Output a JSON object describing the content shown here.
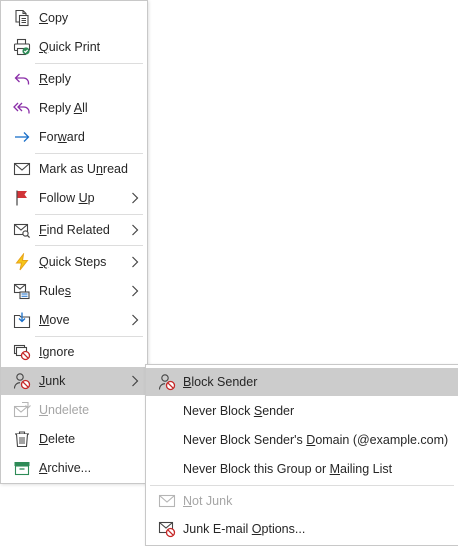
{
  "menu": {
    "items": [
      {
        "pre": "",
        "key": "C",
        "post": "opy",
        "icon": "copy-icon"
      },
      {
        "pre": "",
        "key": "Q",
        "post": "uick Print",
        "icon": "quick-print-icon"
      },
      {
        "pre": "",
        "key": "R",
        "post": "eply",
        "icon": "reply-icon"
      },
      {
        "pre": "Reply ",
        "key": "A",
        "post": "ll",
        "icon": "reply-all-icon"
      },
      {
        "pre": "For",
        "key": "w",
        "post": "ard",
        "icon": "forward-icon"
      },
      {
        "pre": "Mark as U",
        "key": "n",
        "post": "read",
        "icon": "envelope-icon"
      },
      {
        "pre": "Follow ",
        "key": "U",
        "post": "p",
        "icon": "flag-icon"
      },
      {
        "pre": "",
        "key": "F",
        "post": "ind Related",
        "icon": "find-related-icon"
      },
      {
        "pre": "",
        "key": "Q",
        "post": "uick Steps",
        "icon": "lightning-icon"
      },
      {
        "pre": "Rule",
        "key": "s",
        "post": "",
        "icon": "rules-icon"
      },
      {
        "pre": "",
        "key": "M",
        "post": "ove",
        "icon": "move-icon"
      },
      {
        "pre": "",
        "key": "I",
        "post": "gnore",
        "icon": "ignore-icon"
      },
      {
        "pre": "",
        "key": "J",
        "post": "unk",
        "icon": "junk-icon"
      },
      {
        "pre": "",
        "key": "U",
        "post": "ndelete",
        "icon": "undelete-icon"
      },
      {
        "pre": "",
        "key": "D",
        "post": "elete",
        "icon": "trash-icon"
      },
      {
        "pre": "",
        "key": "A",
        "post": "rchive...",
        "icon": "archive-icon"
      }
    ]
  },
  "junk_menu": {
    "items": [
      {
        "pre": "",
        "key": "B",
        "post": "lock Sender",
        "icon": "block-sender-icon"
      },
      {
        "pre": "Never Block ",
        "key": "S",
        "post": "ender",
        "icon": ""
      },
      {
        "pre": "Never Block Sender's ",
        "key": "D",
        "post": "omain (@example.com)",
        "icon": ""
      },
      {
        "pre": "Never Block this Group or ",
        "key": "M",
        "post": "ailing List",
        "icon": ""
      },
      {
        "pre": "",
        "key": "N",
        "post": "ot Junk",
        "icon": "not-junk-icon"
      },
      {
        "pre": "Junk E-mail ",
        "key": "O",
        "post": "ptions...",
        "icon": "junk-options-icon"
      }
    ]
  },
  "colors": {
    "highlight": "#cccccc",
    "reply_purple": "#8a2ea8",
    "forward_blue": "#1a6fc9",
    "flag_red": "#d13438",
    "lightning_orange": "#e8a317",
    "archive_green": "#2e8b57",
    "block_red": "#c62828",
    "disabled": "#a6a6a6"
  }
}
